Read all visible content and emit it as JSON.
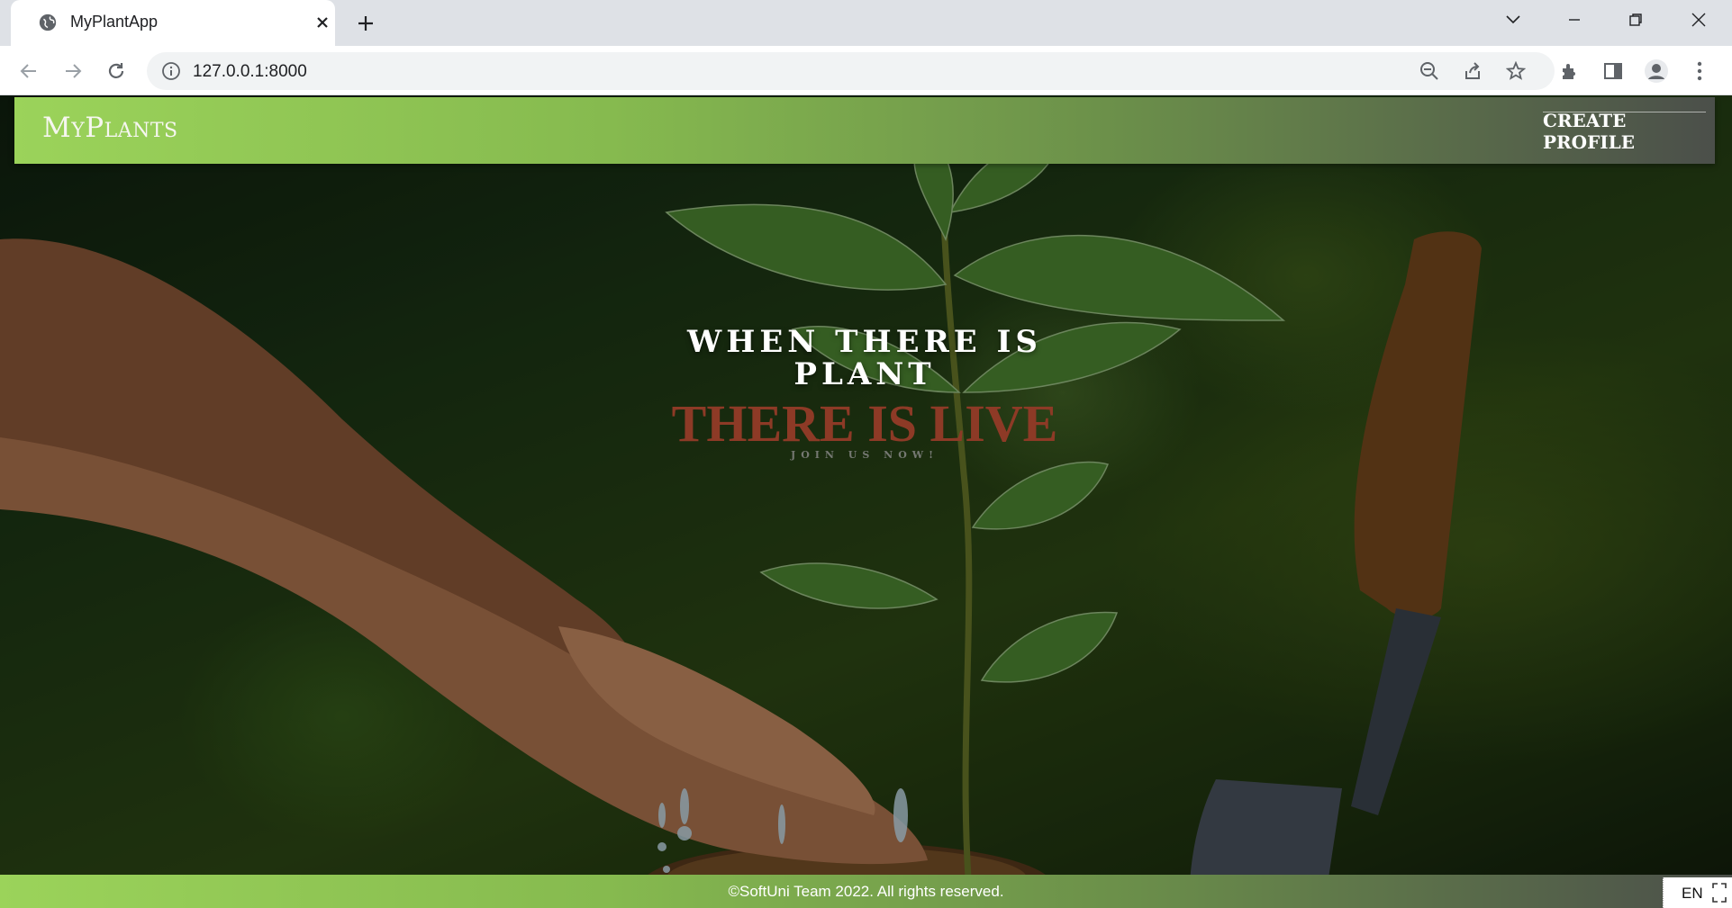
{
  "browser": {
    "tab_title": "MyPlantApp",
    "url": "127.0.0.1:8000",
    "icons": [
      "globe-icon",
      "close-icon",
      "plus-icon",
      "chevron-down-icon",
      "minimize-icon",
      "restore-icon",
      "window-close-icon",
      "back-icon",
      "forward-icon",
      "reload-icon",
      "info-icon",
      "zoom-out-icon",
      "share-icon",
      "star-icon",
      "extensions-icon",
      "side-panel-icon",
      "profile-icon",
      "menu-icon"
    ]
  },
  "page": {
    "brand": "MyPlants",
    "nav": {
      "create_profile": "CREATE PROFILE"
    },
    "hero": {
      "line1": "WHEN THERE IS",
      "line2": "PLANT",
      "accent": "THERE IS LIVE",
      "cta": "JOIN US NOW!"
    },
    "footer": "©SoftUni Team 2022. All rights reserved."
  },
  "taskbar": {
    "language": "EN"
  },
  "colors": {
    "navbar_start": "#9bd35a",
    "navbar_end": "#4b4f4a",
    "accent_text": "#8d3a26"
  }
}
